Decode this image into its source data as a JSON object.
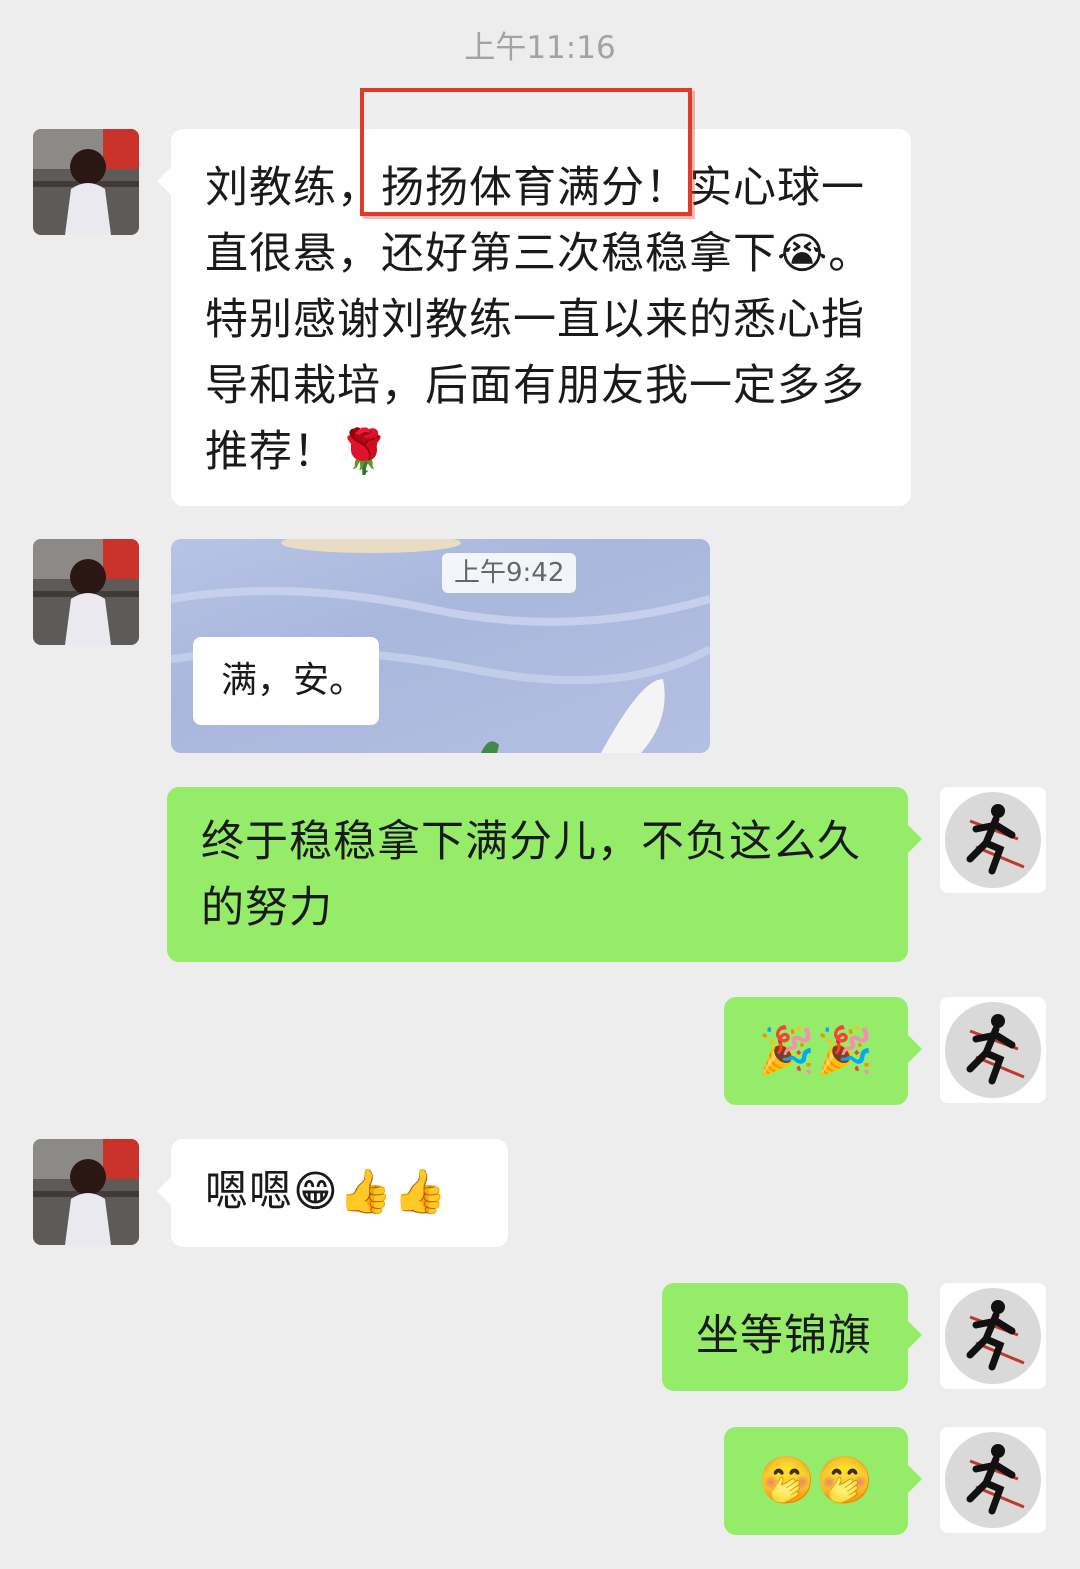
{
  "chat": {
    "top_timestamp": "上午11:16",
    "messages": [
      {
        "side": "in",
        "type": "text",
        "text": "刘教练，扬扬体育满分！实心球一直很悬，还好第三次稳稳拿下😭。特别感谢刘教练一直以来的悉心指导和栽培，后面有朋友我一定多多推荐！🌹",
        "highlight": "扬扬体育满分！"
      },
      {
        "side": "in",
        "type": "image",
        "inner_timestamp": "上午9:42",
        "inner_text": "满，安。"
      },
      {
        "side": "out",
        "type": "text",
        "text": "终于稳稳拿下满分儿，不负这么久的努力"
      },
      {
        "side": "out",
        "type": "emoji",
        "text": "🎉🎉"
      },
      {
        "side": "in",
        "type": "text",
        "text": "嗯嗯😁👍👍"
      },
      {
        "side": "out",
        "type": "text",
        "text": "坐等锦旗"
      },
      {
        "side": "out",
        "type": "emoji",
        "text": "🤭🤭"
      }
    ]
  },
  "icons": {
    "other_avatar": "girl-photo-avatar",
    "my_avatar": "runner-logo-avatar"
  },
  "colors": {
    "background": "#ededed",
    "incoming_bubble": "#ffffff",
    "outgoing_bubble": "#95ec69",
    "highlight": "#e23a2a"
  }
}
